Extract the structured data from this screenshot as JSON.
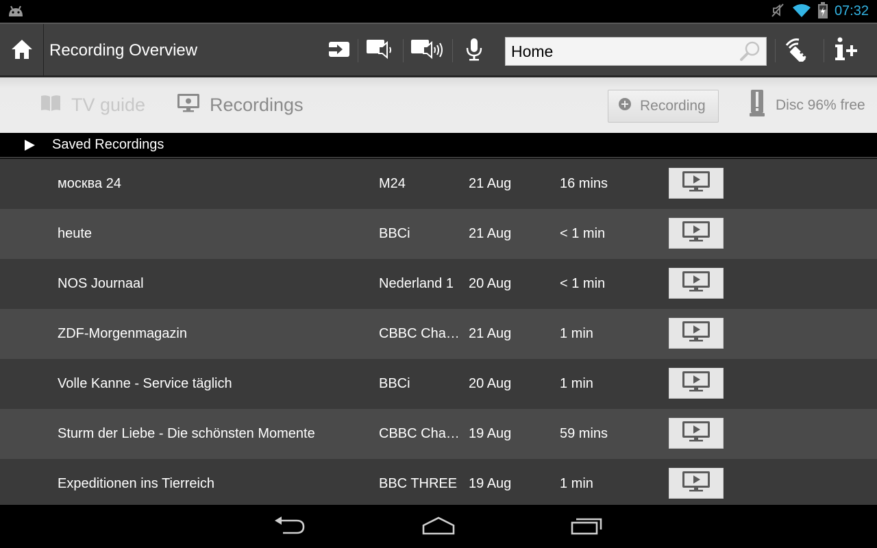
{
  "status_bar": {
    "time": "07:32",
    "icons": [
      "android-icon",
      "mute-icon",
      "wifi-icon",
      "battery-charging-icon"
    ]
  },
  "action_bar": {
    "title": "Recording Overview",
    "tools": [
      "input-switch-icon",
      "volume-down-icon",
      "volume-up-icon",
      "microphone-icon"
    ],
    "search": {
      "value": "Home",
      "placeholder": ""
    },
    "right_icons": [
      "remote-control-icon",
      "info-plus-icon"
    ]
  },
  "tabs": {
    "tv_guide": "TV guide",
    "recordings": "Recordings",
    "record_button": "Recording",
    "disc_status": "Disc 96% free"
  },
  "section": {
    "label": "Saved Recordings"
  },
  "recordings": [
    {
      "title": "москва 24",
      "channel": "M24",
      "date": "21 Aug",
      "duration": "16 mins"
    },
    {
      "title": "heute",
      "channel": "BBCi",
      "date": "21 Aug",
      "duration": "< 1 min"
    },
    {
      "title": "NOS Journaal",
      "channel": "Nederland 1",
      "date": "20 Aug",
      "duration": "< 1 min"
    },
    {
      "title": "ZDF-Morgenmagazin",
      "channel": "CBBC Cha…",
      "date": "21 Aug",
      "duration": "1 min"
    },
    {
      "title": "Volle Kanne - Service täglich",
      "channel": "BBCi",
      "date": "20 Aug",
      "duration": "1 min"
    },
    {
      "title": "Sturm der Liebe - Die schönsten Momente",
      "channel": "CBBC Cha…",
      "date": "19 Aug",
      "duration": "59 mins"
    },
    {
      "title": "Expeditionen ins Tierreich",
      "channel": "BBC THREE",
      "date": "19 Aug",
      "duration": "1 min"
    }
  ],
  "colors": {
    "clock": "#33b5e5",
    "action_bar": "#404040",
    "row_dark": "#3a3a3a",
    "row_light": "#4a4a4a"
  }
}
